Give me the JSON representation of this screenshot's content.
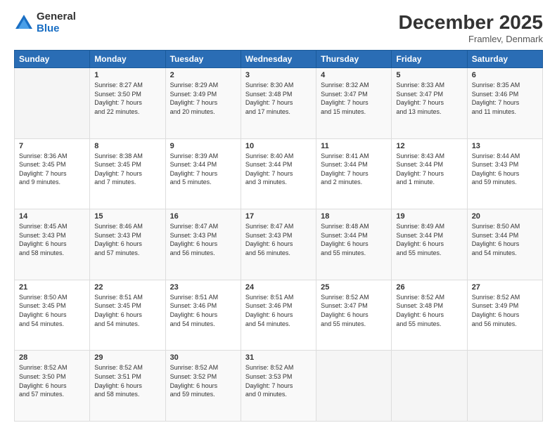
{
  "logo": {
    "general": "General",
    "blue": "Blue"
  },
  "header": {
    "title": "December 2025",
    "subtitle": "Framlev, Denmark"
  },
  "days_header": [
    "Sunday",
    "Monday",
    "Tuesday",
    "Wednesday",
    "Thursday",
    "Friday",
    "Saturday"
  ],
  "weeks": [
    [
      {
        "day": "",
        "info": ""
      },
      {
        "day": "1",
        "info": "Sunrise: 8:27 AM\nSunset: 3:50 PM\nDaylight: 7 hours\nand 22 minutes."
      },
      {
        "day": "2",
        "info": "Sunrise: 8:29 AM\nSunset: 3:49 PM\nDaylight: 7 hours\nand 20 minutes."
      },
      {
        "day": "3",
        "info": "Sunrise: 8:30 AM\nSunset: 3:48 PM\nDaylight: 7 hours\nand 17 minutes."
      },
      {
        "day": "4",
        "info": "Sunrise: 8:32 AM\nSunset: 3:47 PM\nDaylight: 7 hours\nand 15 minutes."
      },
      {
        "day": "5",
        "info": "Sunrise: 8:33 AM\nSunset: 3:47 PM\nDaylight: 7 hours\nand 13 minutes."
      },
      {
        "day": "6",
        "info": "Sunrise: 8:35 AM\nSunset: 3:46 PM\nDaylight: 7 hours\nand 11 minutes."
      }
    ],
    [
      {
        "day": "7",
        "info": "Sunrise: 8:36 AM\nSunset: 3:45 PM\nDaylight: 7 hours\nand 9 minutes."
      },
      {
        "day": "8",
        "info": "Sunrise: 8:38 AM\nSunset: 3:45 PM\nDaylight: 7 hours\nand 7 minutes."
      },
      {
        "day": "9",
        "info": "Sunrise: 8:39 AM\nSunset: 3:44 PM\nDaylight: 7 hours\nand 5 minutes."
      },
      {
        "day": "10",
        "info": "Sunrise: 8:40 AM\nSunset: 3:44 PM\nDaylight: 7 hours\nand 3 minutes."
      },
      {
        "day": "11",
        "info": "Sunrise: 8:41 AM\nSunset: 3:44 PM\nDaylight: 7 hours\nand 2 minutes."
      },
      {
        "day": "12",
        "info": "Sunrise: 8:43 AM\nSunset: 3:44 PM\nDaylight: 7 hours\nand 1 minute."
      },
      {
        "day": "13",
        "info": "Sunrise: 8:44 AM\nSunset: 3:43 PM\nDaylight: 6 hours\nand 59 minutes."
      }
    ],
    [
      {
        "day": "14",
        "info": "Sunrise: 8:45 AM\nSunset: 3:43 PM\nDaylight: 6 hours\nand 58 minutes."
      },
      {
        "day": "15",
        "info": "Sunrise: 8:46 AM\nSunset: 3:43 PM\nDaylight: 6 hours\nand 57 minutes."
      },
      {
        "day": "16",
        "info": "Sunrise: 8:47 AM\nSunset: 3:43 PM\nDaylight: 6 hours\nand 56 minutes."
      },
      {
        "day": "17",
        "info": "Sunrise: 8:47 AM\nSunset: 3:43 PM\nDaylight: 6 hours\nand 56 minutes."
      },
      {
        "day": "18",
        "info": "Sunrise: 8:48 AM\nSunset: 3:44 PM\nDaylight: 6 hours\nand 55 minutes."
      },
      {
        "day": "19",
        "info": "Sunrise: 8:49 AM\nSunset: 3:44 PM\nDaylight: 6 hours\nand 55 minutes."
      },
      {
        "day": "20",
        "info": "Sunrise: 8:50 AM\nSunset: 3:44 PM\nDaylight: 6 hours\nand 54 minutes."
      }
    ],
    [
      {
        "day": "21",
        "info": "Sunrise: 8:50 AM\nSunset: 3:45 PM\nDaylight: 6 hours\nand 54 minutes."
      },
      {
        "day": "22",
        "info": "Sunrise: 8:51 AM\nSunset: 3:45 PM\nDaylight: 6 hours\nand 54 minutes."
      },
      {
        "day": "23",
        "info": "Sunrise: 8:51 AM\nSunset: 3:46 PM\nDaylight: 6 hours\nand 54 minutes."
      },
      {
        "day": "24",
        "info": "Sunrise: 8:51 AM\nSunset: 3:46 PM\nDaylight: 6 hours\nand 54 minutes."
      },
      {
        "day": "25",
        "info": "Sunrise: 8:52 AM\nSunset: 3:47 PM\nDaylight: 6 hours\nand 55 minutes."
      },
      {
        "day": "26",
        "info": "Sunrise: 8:52 AM\nSunset: 3:48 PM\nDaylight: 6 hours\nand 55 minutes."
      },
      {
        "day": "27",
        "info": "Sunrise: 8:52 AM\nSunset: 3:49 PM\nDaylight: 6 hours\nand 56 minutes."
      }
    ],
    [
      {
        "day": "28",
        "info": "Sunrise: 8:52 AM\nSunset: 3:50 PM\nDaylight: 6 hours\nand 57 minutes."
      },
      {
        "day": "29",
        "info": "Sunrise: 8:52 AM\nSunset: 3:51 PM\nDaylight: 6 hours\nand 58 minutes."
      },
      {
        "day": "30",
        "info": "Sunrise: 8:52 AM\nSunset: 3:52 PM\nDaylight: 6 hours\nand 59 minutes."
      },
      {
        "day": "31",
        "info": "Sunrise: 8:52 AM\nSunset: 3:53 PM\nDaylight: 7 hours\nand 0 minutes."
      },
      {
        "day": "",
        "info": ""
      },
      {
        "day": "",
        "info": ""
      },
      {
        "day": "",
        "info": ""
      }
    ]
  ]
}
